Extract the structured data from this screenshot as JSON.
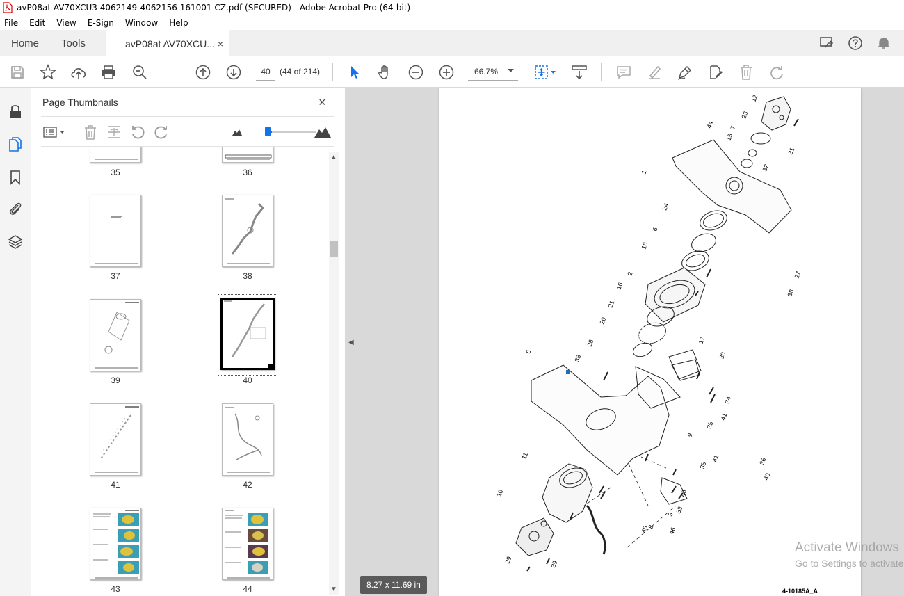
{
  "window": {
    "title": "avP08at AV70XCU3 4062149-4062156 161001 CZ.pdf (SECURED) - Adobe Acrobat Pro (64-bit)"
  },
  "menu": [
    "File",
    "Edit",
    "View",
    "E-Sign",
    "Window",
    "Help"
  ],
  "tabs": {
    "home": "Home",
    "tools": "Tools",
    "document": "avP08at AV70XCU...",
    "document_close": "×"
  },
  "toolbar": {
    "page_number": "40",
    "page_of": "(44 of 214)",
    "zoom": "66.7%"
  },
  "panel": {
    "title": "Page Thumbnails",
    "close": "×",
    "thumbnails": [
      {
        "label": "35"
      },
      {
        "label": "36"
      },
      {
        "label": "37"
      },
      {
        "label": "38"
      },
      {
        "label": "39"
      },
      {
        "label": "40"
      },
      {
        "label": "41"
      },
      {
        "label": "42"
      },
      {
        "label": "43"
      },
      {
        "label": "44"
      }
    ],
    "selected": "40",
    "thumb_size_level": 0.1
  },
  "viewer": {
    "page_size": "8.27 x 11.69 in",
    "drawing_code": "4-10185A_A",
    "part_numbers": [
      "12",
      "23",
      "7",
      "44",
      "15",
      "32",
      "31",
      "1",
      "24",
      "6",
      "16",
      "27",
      "2",
      "38",
      "16",
      "21",
      "20",
      "17",
      "30",
      "28",
      "38",
      "5",
      "34",
      "41",
      "35",
      "9",
      "41",
      "35",
      "36",
      "40",
      "11",
      "40",
      "33",
      "3",
      "46",
      "10",
      "45",
      "8",
      "29",
      "39"
    ]
  },
  "watermark": {
    "line1": "Activate Windows",
    "line2": "Go to Settings to activate Windows."
  },
  "colors": {
    "accent": "#1473e6",
    "background": "#d9d9d9"
  }
}
